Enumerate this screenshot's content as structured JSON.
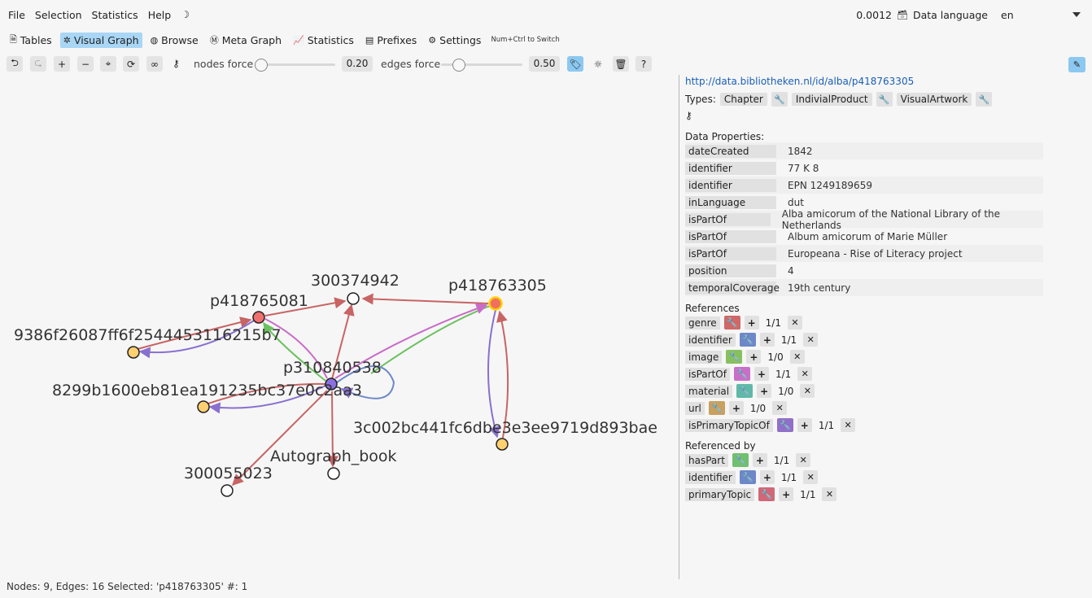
{
  "menu": {
    "items": [
      "File",
      "Selection",
      "Statistics",
      "Help"
    ],
    "theme_icon": "moon-icon",
    "time": "0.0012",
    "data_language_label": "Data language",
    "data_language_value": "en"
  },
  "tabs": [
    {
      "label": "Tables",
      "icon": "table-icon",
      "active": false
    },
    {
      "label": "Visual Graph",
      "icon": "graph-icon",
      "active": true
    },
    {
      "label": "Browse",
      "icon": "globe-icon",
      "active": false
    },
    {
      "label": "Meta Graph",
      "icon": "meta-icon",
      "active": false
    },
    {
      "label": "Statistics",
      "icon": "chart-icon",
      "active": false
    },
    {
      "label": "Prefixes",
      "icon": "document-icon",
      "active": false
    },
    {
      "label": "Settings",
      "icon": "gear-icon",
      "active": false
    }
  ],
  "tab_hint": "Num+Ctrl to Switch",
  "toolbar": {
    "nodes_force_label": "nodes force",
    "nodes_force_value": "0.20",
    "edges_force_label": "edges force",
    "edges_force_value": "0.50"
  },
  "graph": {
    "nodes": [
      {
        "id": "p418763305",
        "label": "p418763305",
        "color": "#f07060"
      },
      {
        "id": "300374942",
        "label": "300374942",
        "color": "#ffffff"
      },
      {
        "id": "p418765081",
        "label": "p418765081",
        "color": "#f07070"
      },
      {
        "id": "9386",
        "label": "9386f26087ff6f2544453116215b7",
        "color": "#ffd070"
      },
      {
        "id": "p310840538",
        "label": "p310840538",
        "color": "#8a70e0"
      },
      {
        "id": "8299",
        "label": "8299b1600eb81ea191235bc37e0c2aa3",
        "color": "#ffd070"
      },
      {
        "id": "3c00",
        "label": "3c002bc441fc6dbe3e3ee9719d893bae",
        "color": "#ffd070"
      },
      {
        "id": "autograph",
        "label": "Autograph_book",
        "color": "#ffffff"
      },
      {
        "id": "300055023",
        "label": "300055023",
        "color": "#ffffff"
      }
    ]
  },
  "panel": {
    "uri": "http://data.bibliotheken.nl/id/alba/p418763305",
    "types_label": "Types:",
    "types": [
      "Chapter",
      "IndivialProduct",
      "VisualArtwork"
    ],
    "data_properties_label": "Data Properties:",
    "data_properties": [
      {
        "name": "dateCreated",
        "value": "1842"
      },
      {
        "name": "identifier",
        "value": "77 K 8"
      },
      {
        "name": "identifier",
        "value": "EPN 1249189659"
      },
      {
        "name": "inLanguage",
        "value": "dut"
      },
      {
        "name": "isPartOf",
        "value": "Alba amicorum of the National Library of the Netherlands"
      },
      {
        "name": "isPartOf",
        "value": "Album amicorum of Marie Müller"
      },
      {
        "name": "isPartOf",
        "value": "Europeana - Rise of Literacy project"
      },
      {
        "name": "position",
        "value": "4"
      },
      {
        "name": "temporalCoverage",
        "value": "19th century"
      }
    ],
    "references_label": "References",
    "references": [
      {
        "name": "genre",
        "color": "#d06868",
        "count": "1/1"
      },
      {
        "name": "identifier",
        "color": "#6c88c8",
        "count": "1/1"
      },
      {
        "name": "image",
        "color": "#88c060",
        "count": "1/0"
      },
      {
        "name": "isPartOf",
        "color": "#c870c8",
        "count": "1/1"
      },
      {
        "name": "material",
        "color": "#60b8a8",
        "count": "1/0"
      },
      {
        "name": "url",
        "color": "#c8a060",
        "count": "1/0"
      },
      {
        "name": "isPrimaryTopicOf",
        "color": "#9070c8",
        "count": "1/1"
      }
    ],
    "referenced_by_label": "Referenced by",
    "referenced_by": [
      {
        "name": "hasPart",
        "color": "#70c070",
        "count": "1/1"
      },
      {
        "name": "identifier",
        "color": "#6c88c8",
        "count": "1/1"
      },
      {
        "name": "primaryTopic",
        "color": "#d06878",
        "count": "1/1"
      }
    ]
  },
  "status": "Nodes: 9, Edges: 16 Selected: 'p418763305' #: 1"
}
